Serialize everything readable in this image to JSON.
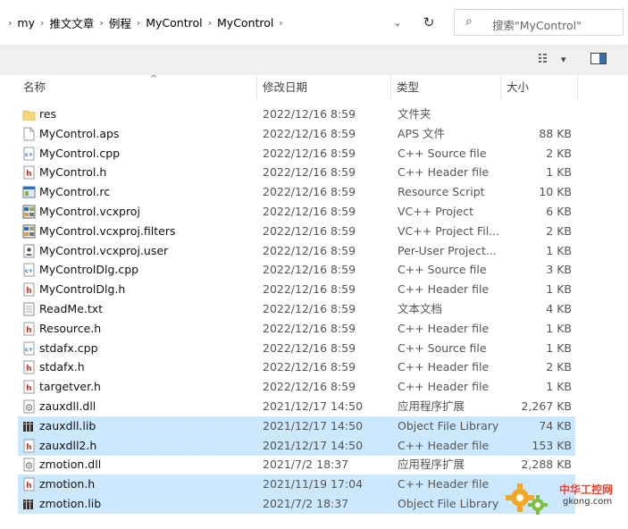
{
  "breadcrumb": [
    "my",
    "推文文章",
    "例程",
    "MyControl",
    "MyControl"
  ],
  "search": {
    "placeholder": "搜索\"MyControl\""
  },
  "columns": {
    "name": "名称",
    "date": "修改日期",
    "type": "类型",
    "size": "大小"
  },
  "files": [
    {
      "name": "res",
      "date": "2022/12/16 8:59",
      "type": "文件夹",
      "size": "",
      "icon": "folder-icon",
      "selected": false
    },
    {
      "name": "MyControl.aps",
      "date": "2022/12/16 8:59",
      "type": "APS 文件",
      "size": "88 KB",
      "icon": "file-icon",
      "selected": false
    },
    {
      "name": "MyControl.cpp",
      "date": "2022/12/16 8:59",
      "type": "C++ Source file",
      "size": "2 KB",
      "icon": "cpp-file-icon",
      "selected": false
    },
    {
      "name": "MyControl.h",
      "date": "2022/12/16 8:59",
      "type": "C++ Header file",
      "size": "1 KB",
      "icon": "header-file-icon",
      "selected": false
    },
    {
      "name": "MyControl.rc",
      "date": "2022/12/16 8:59",
      "type": "Resource Script",
      "size": "10 KB",
      "icon": "resource-file-icon",
      "selected": false
    },
    {
      "name": "MyControl.vcxproj",
      "date": "2022/12/16 8:59",
      "type": "VC++ Project",
      "size": "6 KB",
      "icon": "vcxproj-file-icon",
      "selected": false
    },
    {
      "name": "MyControl.vcxproj.filters",
      "date": "2022/12/16 8:59",
      "type": "VC++ Project Fil...",
      "size": "2 KB",
      "icon": "filters-file-icon",
      "selected": false
    },
    {
      "name": "MyControl.vcxproj.user",
      "date": "2022/12/16 8:59",
      "type": "Per-User Project...",
      "size": "1 KB",
      "icon": "user-file-icon",
      "selected": false
    },
    {
      "name": "MyControlDlg.cpp",
      "date": "2022/12/16 8:59",
      "type": "C++ Source file",
      "size": "3 KB",
      "icon": "cpp-file-icon",
      "selected": false
    },
    {
      "name": "MyControlDlg.h",
      "date": "2022/12/16 8:59",
      "type": "C++ Header file",
      "size": "1 KB",
      "icon": "header-file-icon",
      "selected": false
    },
    {
      "name": "ReadMe.txt",
      "date": "2022/12/16 8:59",
      "type": "文本文档",
      "size": "4 KB",
      "icon": "text-file-icon",
      "selected": false
    },
    {
      "name": "Resource.h",
      "date": "2022/12/16 8:59",
      "type": "C++ Header file",
      "size": "1 KB",
      "icon": "header-file-icon",
      "selected": false
    },
    {
      "name": "stdafx.cpp",
      "date": "2022/12/16 8:59",
      "type": "C++ Source file",
      "size": "1 KB",
      "icon": "cpp-file-icon",
      "selected": false
    },
    {
      "name": "stdafx.h",
      "date": "2022/12/16 8:59",
      "type": "C++ Header file",
      "size": "2 KB",
      "icon": "header-file-icon",
      "selected": false
    },
    {
      "name": "targetver.h",
      "date": "2022/12/16 8:59",
      "type": "C++ Header file",
      "size": "1 KB",
      "icon": "header-file-icon",
      "selected": false
    },
    {
      "name": "zauxdll.dll",
      "date": "2021/12/17 14:50",
      "type": "应用程序扩展",
      "size": "2,267 KB",
      "icon": "dll-file-icon",
      "selected": false
    },
    {
      "name": "zauxdll.lib",
      "date": "2021/12/17 14:50",
      "type": "Object File Library",
      "size": "74 KB",
      "icon": "lib-file-icon",
      "selected": true
    },
    {
      "name": "zauxdll2.h",
      "date": "2021/12/17 14:50",
      "type": "C++ Header file",
      "size": "153 KB",
      "icon": "header-file-icon",
      "selected": true
    },
    {
      "name": "zmotion.dll",
      "date": "2021/7/2 18:37",
      "type": "应用程序扩展",
      "size": "2,288 KB",
      "icon": "dll-file-icon",
      "selected": false
    },
    {
      "name": "zmotion.h",
      "date": "2021/11/19 17:04",
      "type": "C++ Header file",
      "size": "",
      "icon": "header-file-icon",
      "selected": true
    },
    {
      "name": "zmotion.lib",
      "date": "2021/7/2 18:37",
      "type": "Object File Library",
      "size": "",
      "icon": "lib-file-icon",
      "selected": true
    }
  ],
  "watermark": {
    "text1": "中华工控网",
    "text2": "gkong.com"
  },
  "colors": {
    "selection": "#cce8ff",
    "toolbar": "#f0f0f0",
    "folder": "#f8d775",
    "header_icon": "#c0392b",
    "cpp_icon": "#2f6db5"
  }
}
